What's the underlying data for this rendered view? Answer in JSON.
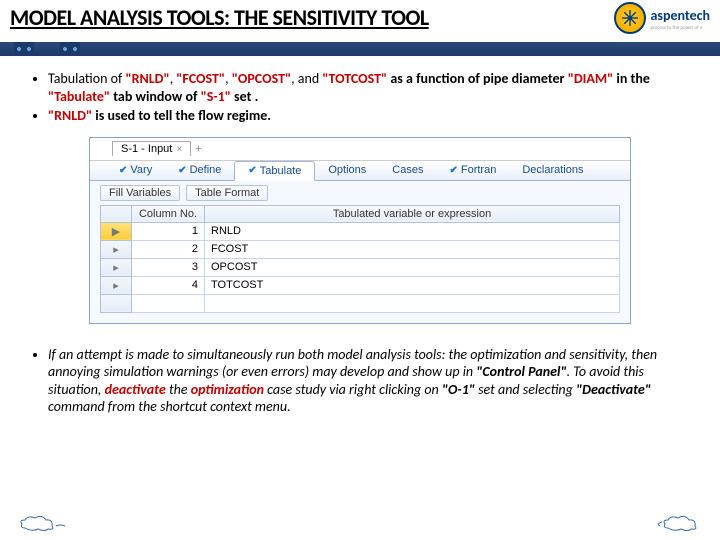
{
  "header": {
    "title": "MODEL ANALYSIS TOOLS: THE SENSITIVITY TOOL",
    "logo_name": "aspentech",
    "logo_tag": "process to the power of e"
  },
  "bullets": {
    "b1_pre": "Tabulation of ",
    "b1_q1": "\"RNLD\"",
    "b1_c1": ", ",
    "b1_q2": "\"FCOST\"",
    "b1_c2": ", ",
    "b1_q3": "\"OPCOST\"",
    "b1_c3": ", and ",
    "b1_q4": "\"TOTCOST\"",
    "b1_mid1": " as a function of pipe diameter ",
    "b1_q5": "\"DIAM\"",
    "b1_mid2": " in the ",
    "b1_q6": "\"Tabulate\"",
    "b1_mid3": " tab window of ",
    "b1_q7": "\"S-1\"",
    "b1_end": " set .",
    "b2_q1": "\"RNLD\"",
    "b2_rest": " is used to tell the flow regime."
  },
  "app": {
    "title": "S-1 - Input",
    "plus": "+",
    "tabs": {
      "vary": "Vary",
      "define": "Define",
      "tabulate": "Tabulate",
      "options": "Options",
      "cases": "Cases",
      "fortran": "Fortran",
      "declarations": "Declarations"
    },
    "sub": {
      "fill": "Fill Variables",
      "fmt": "Table Format"
    },
    "cols": {
      "num": "Column No.",
      "expr": "Tabulated variable or expression"
    },
    "rows": [
      {
        "n": "1",
        "v": "RNLD"
      },
      {
        "n": "2",
        "v": "FCOST"
      },
      {
        "n": "3",
        "v": "OPCOST"
      },
      {
        "n": "4",
        "v": "TOTCOST"
      }
    ]
  },
  "bottom": {
    "pre": "If an attempt is made to simultaneously run both model analysis tools: the optimization and sensitivity, then annoying simulation warnings (or even errors) may develop and show up in ",
    "q1": "\"Control Panel\"",
    "mid1": ". To avoid this situation, ",
    "dq1": "deactivate",
    "mid2": " the ",
    "dq2": "optimization",
    "mid3": " case study via right clicking on ",
    "q2": "\"O-1\"",
    "mid4": " set and selecting ",
    "q3": "\"Deactivate\"",
    "end": " command from the shortcut context menu."
  }
}
